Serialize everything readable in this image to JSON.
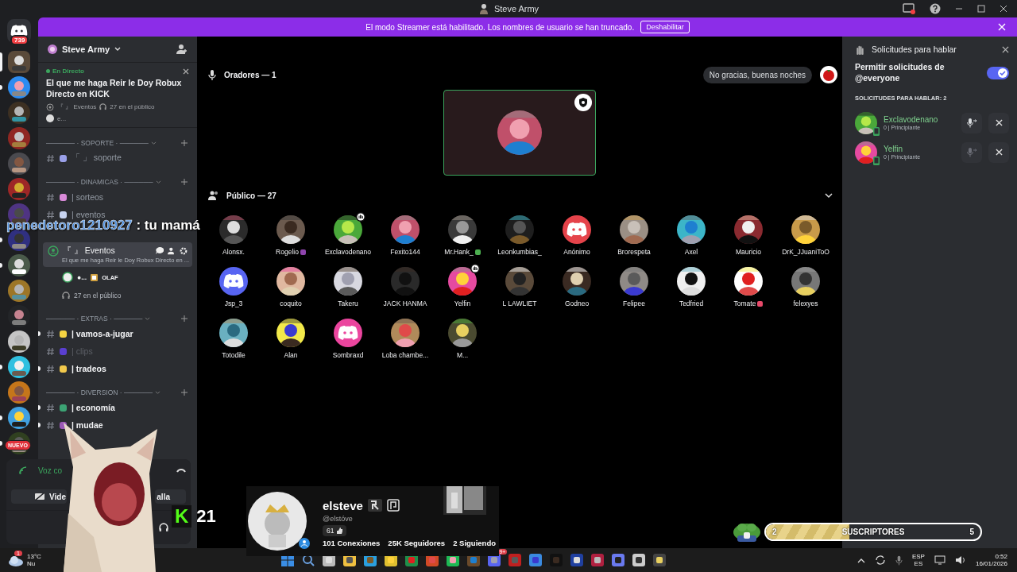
{
  "window": {
    "title": "Steve Army"
  },
  "streamer_banner": {
    "text": "El modo Streamer está habilitado. Los nombres de usuario se han truncado.",
    "button": "Deshabilitar"
  },
  "server_rail": {
    "home_badge": "739",
    "new_badge": "NUEVO",
    "servers": [
      {
        "selected": true,
        "unread": false
      },
      {
        "selected": false,
        "unread": true
      },
      {
        "selected": false,
        "unread": false
      },
      {
        "selected": false,
        "unread": false
      },
      {
        "selected": false,
        "unread": false
      },
      {
        "selected": false,
        "unread": false
      },
      {
        "selected": false,
        "unread": false
      },
      {
        "selected": false,
        "unread": true
      },
      {
        "selected": false,
        "unread": true
      },
      {
        "selected": false,
        "unread": false
      },
      {
        "selected": false,
        "unread": false
      },
      {
        "selected": false,
        "unread": false
      },
      {
        "selected": false,
        "unread": true
      },
      {
        "selected": false,
        "unread": false
      },
      {
        "selected": false,
        "unread": true
      },
      {
        "selected": false,
        "unread": true
      }
    ]
  },
  "channel_sidebar": {
    "server_name": "Steve Army",
    "live_event": {
      "status": "En Directo",
      "title": "El que me haga Reir le Doy Robux Directo en KICK",
      "channel": "『 』 Eventos",
      "audience": "27 en el público",
      "host": "e..."
    },
    "categories": [
      {
        "label": "────── · SOPORTE · ──────",
        "channels": [
          {
            "kind": "text",
            "name": "「 」 soporte",
            "unread": false,
            "muted": false,
            "color": "#9aa0e8"
          }
        ]
      },
      {
        "label": "────── · DINAMICAS · ──────",
        "channels": [
          {
            "kind": "text",
            "name": "| sorteos",
            "unread": false,
            "muted": false,
            "color": "#d88ad8"
          },
          {
            "kind": "text",
            "name": "| eventos",
            "unread": false,
            "muted": false,
            "color": "#c8d4f0"
          },
          {
            "kind": "stage",
            "name": "『 』 Eventos",
            "topic": "El que me haga Reir le Doy Robux Directo en ...",
            "speaker": "●...",
            "speaker_role": "OLAF",
            "audience": "27 en el público",
            "selected": true
          }
        ]
      },
      {
        "label": "────── · EXTRAS · ──────",
        "channels": [
          {
            "kind": "text",
            "name": "| vamos-a-jugar",
            "unread": true,
            "muted": false,
            "color": "#f5d442"
          },
          {
            "kind": "text",
            "name": "| clips",
            "unread": false,
            "muted": true,
            "color": "#5a3fd0"
          },
          {
            "kind": "text",
            "name": "| tradeos",
            "unread": true,
            "muted": false,
            "color": "#f2c94c"
          }
        ]
      },
      {
        "label": "────── · DIVERSION · ──────",
        "channels": [
          {
            "kind": "text",
            "name": "| economía",
            "unread": true,
            "muted": false,
            "color": "#3ca374"
          },
          {
            "kind": "text",
            "name": "| mudae",
            "unread": true,
            "muted": false,
            "color": "#9b59b6"
          }
        ]
      }
    ],
    "voice_panel": {
      "status": "Voz co",
      "buttons": [
        "Vide",
        "alla"
      ]
    }
  },
  "stage": {
    "speakers_title": "Oradores — 1",
    "dismiss_button": "No gracias, buenas noches",
    "audience_title": "Público — 27",
    "audience": [
      {
        "name": "Alonsx.",
        "kind": "picture",
        "hand_raised": false
      },
      {
        "name": "Rogelio",
        "kind": "picture",
        "hand_raised": false,
        "emoji": {
          "color": "#8e44ad"
        }
      },
      {
        "name": "Exclavodenano",
        "kind": "picture",
        "hand_raised": true
      },
      {
        "name": "Fexito144",
        "kind": "picture",
        "hand_raised": false
      },
      {
        "name": "Mr.Hank_",
        "kind": "picture",
        "hand_raised": false,
        "emoji": {
          "color": "#4caf50"
        }
      },
      {
        "name": "Leonkumbias_",
        "kind": "picture",
        "hand_raised": false
      },
      {
        "name": "Anónimo",
        "kind": "discord",
        "color": "#e5434a",
        "hand_raised": false
      },
      {
        "name": "Brorespeta",
        "kind": "picture",
        "hand_raised": false
      },
      {
        "name": "Axel",
        "kind": "picture",
        "hand_raised": false
      },
      {
        "name": "Mauricio",
        "kind": "picture",
        "hand_raised": false
      },
      {
        "name": "DrK_JJuaniToO",
        "kind": "picture",
        "hand_raised": false
      },
      {
        "name": "Jsp_3",
        "kind": "discord",
        "color": "#5865f2",
        "hand_raised": false
      },
      {
        "name": "coquito",
        "kind": "picture",
        "hand_raised": false
      },
      {
        "name": "Takeru",
        "kind": "picture",
        "hand_raised": false
      },
      {
        "name": "JACK HANMA",
        "kind": "picture",
        "hand_raised": false
      },
      {
        "name": "Yelfin",
        "kind": "picture",
        "hand_raised": true
      },
      {
        "name": "L LAWLIET",
        "kind": "picture",
        "hand_raised": false
      },
      {
        "name": "Godneo",
        "kind": "picture",
        "hand_raised": false
      },
      {
        "name": "Felipee",
        "kind": "picture",
        "hand_raised": false
      },
      {
        "name": "Tedfried",
        "kind": "picture",
        "hand_raised": false
      },
      {
        "name": "Tomate",
        "kind": "picture",
        "hand_raised": false,
        "emoji": {
          "color": "#e84a6a"
        }
      },
      {
        "name": "felexyes",
        "kind": "picture",
        "hand_raised": false
      },
      {
        "name": "Totodile",
        "kind": "picture",
        "hand_raised": false
      },
      {
        "name": "Alan",
        "kind": "picture",
        "hand_raised": false
      },
      {
        "name": "Sombraxd",
        "kind": "discord",
        "color": "#eb459e",
        "hand_raised": false
      },
      {
        "name": "Loba chambe...",
        "kind": "picture",
        "hand_raised": false
      },
      {
        "name": "M...",
        "kind": "picture",
        "hand_raised": false
      }
    ]
  },
  "requests_panel": {
    "title": "Solicitudes para hablar",
    "allow_label": "Permitir solicitudes de @everyone",
    "allow_on": true,
    "count_label": "SOLICITUDES PARA HABLAR: 2",
    "requests": [
      {
        "name": "Exclavodenano",
        "subtitle": "0 | Principiante",
        "invite_disabled": false
      },
      {
        "name": "Yelfin",
        "subtitle": "0 | Principiante",
        "invite_disabled": true
      }
    ]
  },
  "overlays": {
    "chat": {
      "user": "penedetoro1210927",
      "message": " : tu mamá"
    },
    "profile_card": {
      "name": "elsteve",
      "handle": "@elstóve",
      "likes": "61",
      "stats": [
        "101 Conexiones",
        "25K Seguidores",
        "2 Siguiendo"
      ]
    },
    "kick": {
      "logo": "K",
      "count": "21"
    },
    "subscribers": {
      "current": "2",
      "label": "SUSCRIPTORES",
      "goal": "5",
      "level": 0.39
    }
  },
  "taskbar": {
    "weather_badge": "1",
    "weather": "13°C",
    "weather_sub": "Nu",
    "discord_badge": "9+",
    "language": "ESP",
    "layout": "ES",
    "time": "0:52",
    "date": "16/01/2026"
  }
}
